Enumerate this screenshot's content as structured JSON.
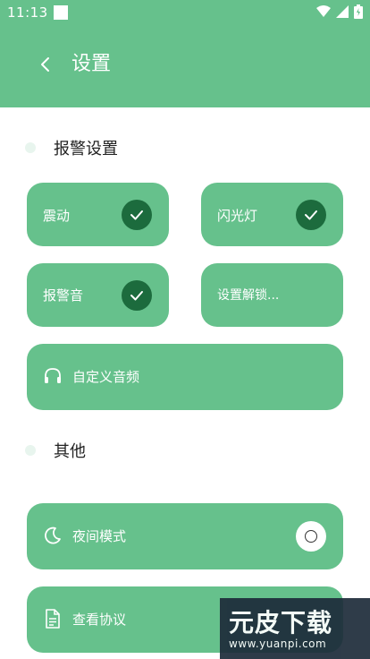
{
  "status_bar": {
    "time": "11:13"
  },
  "header": {
    "title": "设置"
  },
  "sections": {
    "alarm": {
      "title": "报警设置"
    },
    "other": {
      "title": "其他"
    }
  },
  "alarm_options": {
    "vibrate": {
      "label": "震动",
      "checked": true
    },
    "flash": {
      "label": "闪光灯",
      "checked": true
    },
    "sound": {
      "label": "报警音",
      "checked": true
    },
    "unlock": {
      "label": "设置解锁..."
    },
    "custom_audio": {
      "label": "自定义音频",
      "icon": "headphones-icon"
    }
  },
  "other_options": {
    "night_mode": {
      "label": "夜间模式",
      "icon": "moon-icon",
      "enabled": false
    },
    "agreement": {
      "label": "查看协议",
      "icon": "document-icon"
    }
  },
  "watermark": {
    "brand": "元皮下载",
    "url": "www.yuanpi.com"
  },
  "colors": {
    "primary": "#66c18c",
    "check": "#1c6b3d",
    "background": "#ffffff"
  }
}
